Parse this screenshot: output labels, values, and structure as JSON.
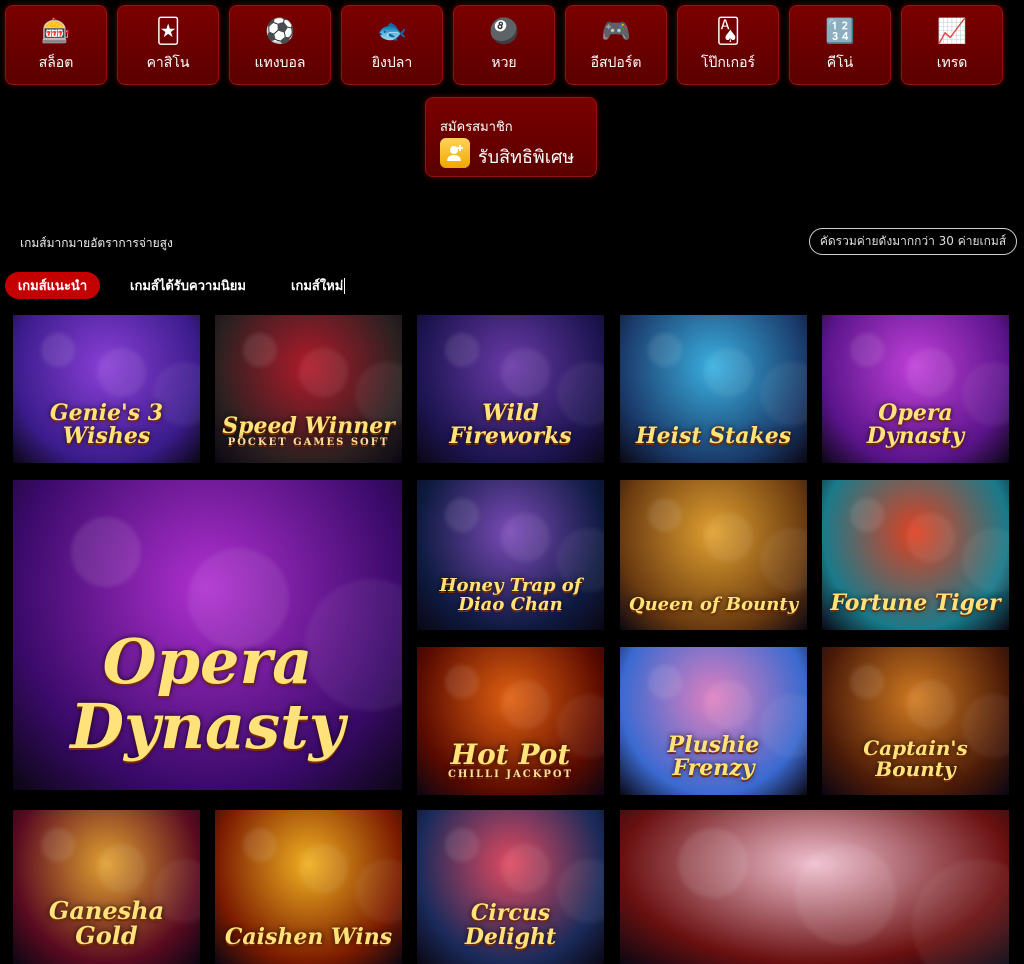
{
  "categories": [
    {
      "label": "สล็อต",
      "icon": "slot-machine-icon",
      "glyph": "🎰"
    },
    {
      "label": "คาสิโน",
      "icon": "playing-cards-icon",
      "glyph": "🃏"
    },
    {
      "label": "แทงบอล",
      "icon": "football-icon",
      "glyph": "⚽"
    },
    {
      "label": "ยิงปลา",
      "icon": "fish-shooting-icon",
      "glyph": "🐟"
    },
    {
      "label": "หวย",
      "icon": "lottery-balls-icon",
      "glyph": "🎱"
    },
    {
      "label": "อีสปอร์ต",
      "icon": "gamepad-icon",
      "glyph": "🎮"
    },
    {
      "label": "โป๊กเกอร์",
      "icon": "poker-cards-icon",
      "glyph": "🂡"
    },
    {
      "label": "คีโน่",
      "icon": "keno-icon",
      "glyph": "🔢"
    },
    {
      "label": "เทรด",
      "icon": "trade-icon",
      "glyph": "📈"
    }
  ],
  "register": {
    "small": "สมัครสมาชิก",
    "big": "รับสิทธิพิเศษ",
    "icon": "add-user-icon"
  },
  "headline": "เกมส์มากมายอัตราการจ่ายสูง",
  "providers_button": "คัดรวมค่ายดังมากกว่า 30 ค่ายเกมส์",
  "tabs": [
    "เกมส์แนะนำ",
    "เกมส์ได้รับความนิยม",
    "เกมส์ใหม่"
  ],
  "games": [
    {
      "title": "Genie's 3 Wishes",
      "sub": "",
      "color_a": "#3b1c8c",
      "color_b": "#8a3fd6"
    },
    {
      "title": "Speed Winner",
      "sub": "POCKET GAMES SOFT",
      "color_a": "#2a2020",
      "color_b": "#b01a2a"
    },
    {
      "title": "Wild Fireworks",
      "sub": "",
      "color_a": "#1c1450",
      "color_b": "#6a3aa8"
    },
    {
      "title": "Heist Stakes",
      "sub": "",
      "color_a": "#1a3a6a",
      "color_b": "#3ab0e0"
    },
    {
      "title": "Opera Dynasty",
      "sub": "",
      "color_a": "#5a148a",
      "color_b": "#c040d8"
    },
    {
      "title": "Opera Dynasty",
      "sub": "",
      "color_a": "#3a0a6a",
      "color_b": "#b030d0"
    },
    {
      "title": "Honey Trap of Diao Chan",
      "sub": "",
      "color_a": "#0e1a40",
      "color_b": "#7a4ab8"
    },
    {
      "title": "Queen of Bounty",
      "sub": "",
      "color_a": "#6a3a10",
      "color_b": "#e0a030"
    },
    {
      "title": "Fortune Tiger",
      "sub": "",
      "color_a": "#1a7a8a",
      "color_b": "#e04020"
    },
    {
      "title": "Hot Pot",
      "sub": "CHILLI JACKPOT",
      "color_a": "#5a0a00",
      "color_b": "#e06010"
    },
    {
      "title": "Plushie Frenzy",
      "sub": "",
      "color_a": "#3a6ad0",
      "color_b": "#e080c0"
    },
    {
      "title": "Captain's Bounty",
      "sub": "",
      "color_a": "#4a1a08",
      "color_b": "#d07a20"
    },
    {
      "title": "Ganesha Gold",
      "sub": "",
      "color_a": "#5a0a20",
      "color_b": "#e0a030"
    },
    {
      "title": "Caishen Wins",
      "sub": "",
      "color_a": "#7a1a00",
      "color_b": "#f0b020"
    },
    {
      "title": "Circus Delight",
      "sub": "",
      "color_a": "#1a2a5a",
      "color_b": "#e04a60"
    },
    {
      "title": "",
      "sub": "",
      "color_a": "#6a1010",
      "color_b": "#f0c0d0"
    }
  ]
}
